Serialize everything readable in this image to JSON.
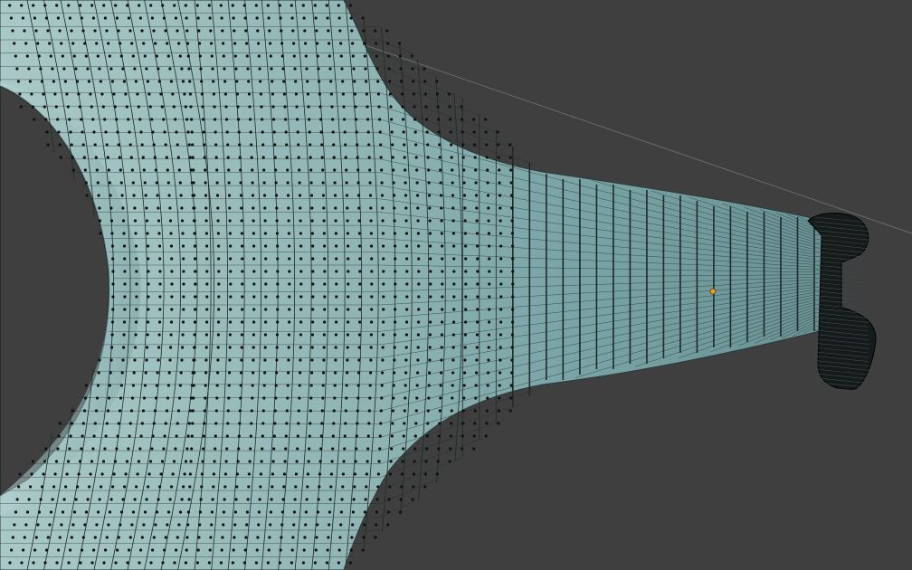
{
  "viewport": {
    "background_color": "#3f3f3f",
    "mesh_color": "#8fb4b3",
    "mesh_shadow_color": "#5c7f82",
    "wire_color": "#1e2a2b",
    "vertex_color": "#111111",
    "origin_color": "#f0a020",
    "guide_line_color": "#6a6a6a",
    "axis_line_color": "#7a4a40",
    "mode": "edit-mode",
    "display": "wireframe-with-vertices",
    "icons": {
      "mesh": "mesh-object",
      "origin": "origin-point",
      "vertex": "vertex-dot"
    }
  }
}
